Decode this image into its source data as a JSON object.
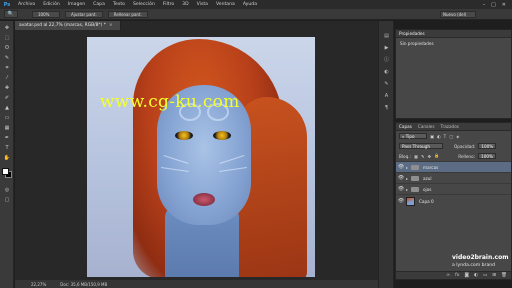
{
  "app": {
    "logo": "Ps"
  },
  "menu": [
    "Archivo",
    "Edición",
    "Imagen",
    "Capa",
    "Texto",
    "Selección",
    "Filtro",
    "3D",
    "Vista",
    "Ventana",
    "Ayuda"
  ],
  "window_controls": [
    "–",
    "□",
    "✕"
  ],
  "options_bar": {
    "zoom": "100%",
    "fit_button": "Ajustar pant.",
    "fill_button": "Rellenar pant.",
    "workspace": "Nuevo (del)"
  },
  "document": {
    "tab_title": "avatar.psd al 22,7% (marcas, RGB/8*) *",
    "close": "×"
  },
  "status_bar": {
    "zoom": "22,27%",
    "doc_info": "Doc: 35,6 MB/150,9 MB"
  },
  "watermark": "www.cg-ku.com",
  "properties_panel": {
    "title": "Propiedades",
    "body": "Sin propiedades"
  },
  "layers_panel": {
    "tabs": [
      "Capas",
      "Canales",
      "Trazados"
    ],
    "filter_kind": "Tipo",
    "blend_mode": "Pass Through",
    "opacity_label": "Opacidad:",
    "opacity": "100%",
    "lock_label": "Bloq.:",
    "fill_label": "Relleno:",
    "fill": "100%",
    "layers": [
      {
        "name": "marcas",
        "type": "group",
        "selected": true
      },
      {
        "name": "azul",
        "type": "group",
        "selected": false
      },
      {
        "name": "ojos",
        "type": "group",
        "selected": false
      },
      {
        "name": "Capa 0",
        "type": "image",
        "selected": false
      }
    ]
  },
  "branding": {
    "name": "video2brain.com",
    "sub": "a lynda.com brand"
  },
  "colors": {
    "accent": "#5d6c85",
    "logo": "#3fa2e8",
    "watermark": "#f4ff2a",
    "foreground_swatch": "#ffffff",
    "background_swatch": "#000000"
  }
}
